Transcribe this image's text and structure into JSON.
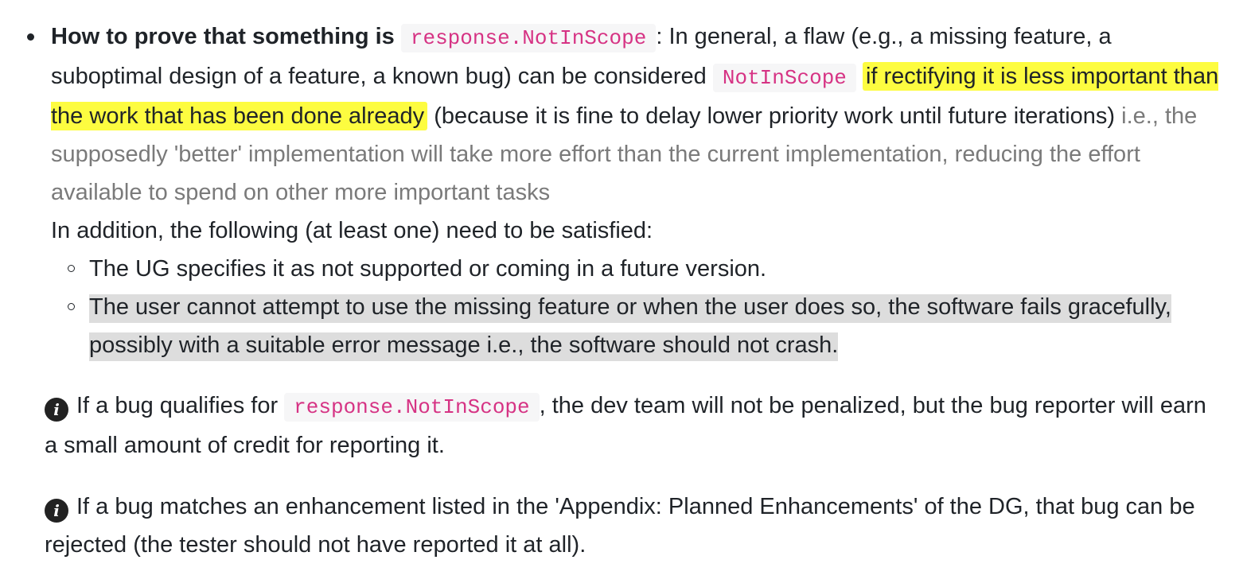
{
  "bullet": {
    "heading": "How to prove that something is",
    "heading_code": "response.NotInScope",
    "text1": ": In general, a flaw (e.g., a missing feature, a suboptimal design of a feature, a known bug) can be considered",
    "code2": "NotInScope",
    "highlight": "if rectifying it is less important than the work that has been done already",
    "text2": "(because it is fine to delay lower priority work until future iterations)",
    "muted": "i.e., the supposedly 'better' implementation will take more effort than the current implementation, reducing the effort available to spend on other more important tasks",
    "addition": "In addition, the following (at least one) need to be satisfied:",
    "sub_items": [
      "The UG specifies it as not supported or coming in a future version.",
      "The user cannot attempt to use the missing feature or when the user does so, the software fails gracefully, possibly with a suitable error message i.e., the software should not crash."
    ]
  },
  "info1": {
    "icon": "info-icon",
    "text1": "If a bug qualifies for",
    "code": "response.NotInScope",
    "text2": ", the dev team will not be penalized, but the bug reporter will earn a small amount of credit for reporting it."
  },
  "info2": {
    "icon": "info-icon",
    "text": "If a bug matches an enhancement listed in the 'Appendix: Planned Enhancements' of the DG, that bug can be rejected (the tester should not have reported it at all)."
  },
  "colors": {
    "code_text": "#d63384",
    "code_bg": "#f6f6f7",
    "highlight": "#fdfc40",
    "muted_text": "#7a7a7a",
    "selected_bg": "#dddddd"
  }
}
